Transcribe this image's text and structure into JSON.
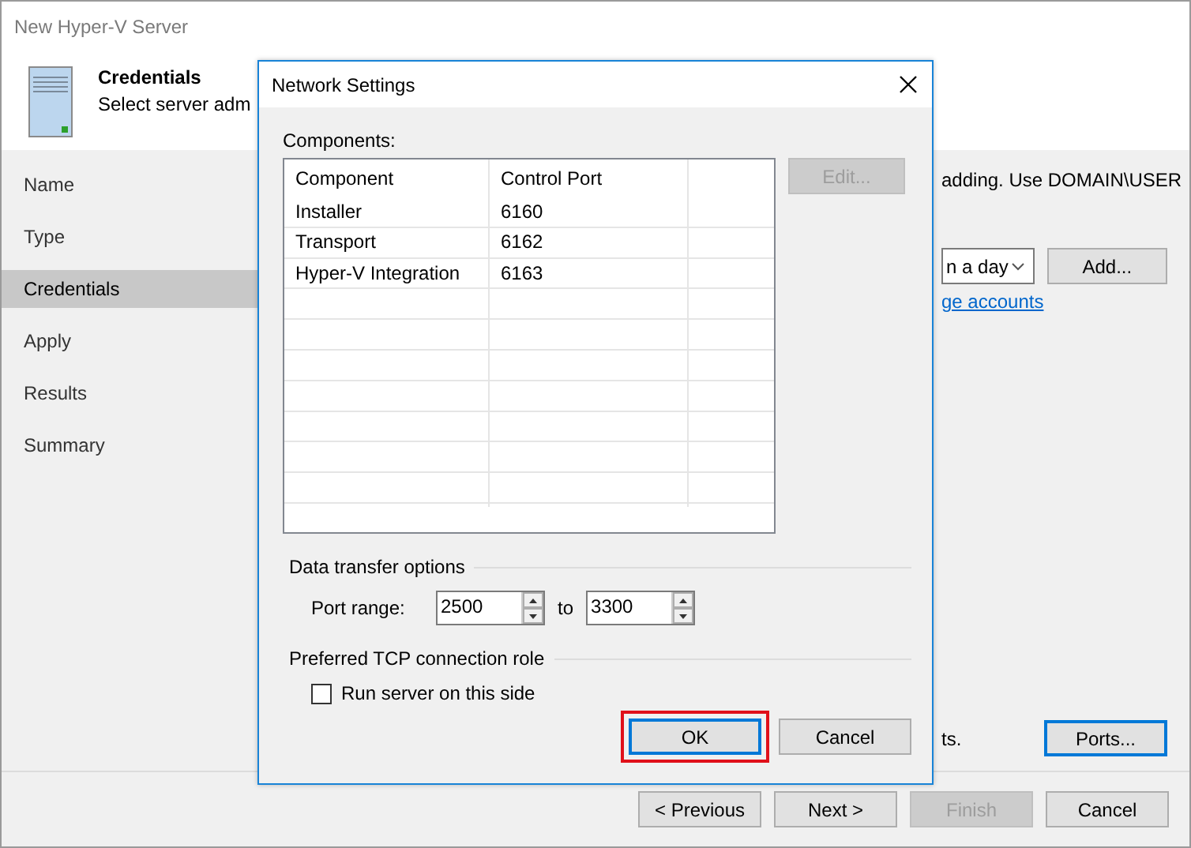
{
  "window": {
    "title": "New Hyper-V Server"
  },
  "header": {
    "title": "Credentials",
    "subtitle": "Select server adm"
  },
  "steps": [
    {
      "label": "Name",
      "selected": false
    },
    {
      "label": "Type",
      "selected": false
    },
    {
      "label": "Credentials",
      "selected": true
    },
    {
      "label": "Apply",
      "selected": false
    },
    {
      "label": "Results",
      "selected": false
    },
    {
      "label": "Summary",
      "selected": false
    }
  ],
  "credentials_panel": {
    "hint": "adding. Use DOMAIN\\USER",
    "dropdown_value": "n a day",
    "add_button": "Add...",
    "link": "ge accounts",
    "ports_hint": "ts.",
    "ports_button": {
      "label": "Ports...",
      "focused": true
    }
  },
  "footer_buttons": [
    {
      "label": "< Previous",
      "disabled": false
    },
    {
      "label": "Next >",
      "disabled": false
    },
    {
      "label": "Finish",
      "disabled": true
    },
    {
      "label": "Cancel",
      "disabled": false
    }
  ],
  "dialog": {
    "title": "Network Settings",
    "components_label": "Components:",
    "table": {
      "columns": [
        "Component",
        "Control Port"
      ],
      "rows": [
        [
          "Installer",
          "6160"
        ],
        [
          "Transport",
          "6162"
        ],
        [
          "Hyper-V Integration",
          "6163"
        ]
      ]
    },
    "edit_button": {
      "label": "Edit...",
      "disabled": true
    },
    "data_transfer": {
      "heading": "Data transfer options",
      "port_range_label": "Port range:",
      "from": "2500",
      "to_label": "to",
      "to": "3300"
    },
    "tcp_role": {
      "heading": "Preferred TCP connection role",
      "checkbox_label": "Run server on this side",
      "checked": false
    },
    "buttons": [
      {
        "label": "OK",
        "focused": true,
        "highlighted": true
      },
      {
        "label": "Cancel",
        "focused": false,
        "highlighted": false
      }
    ]
  }
}
